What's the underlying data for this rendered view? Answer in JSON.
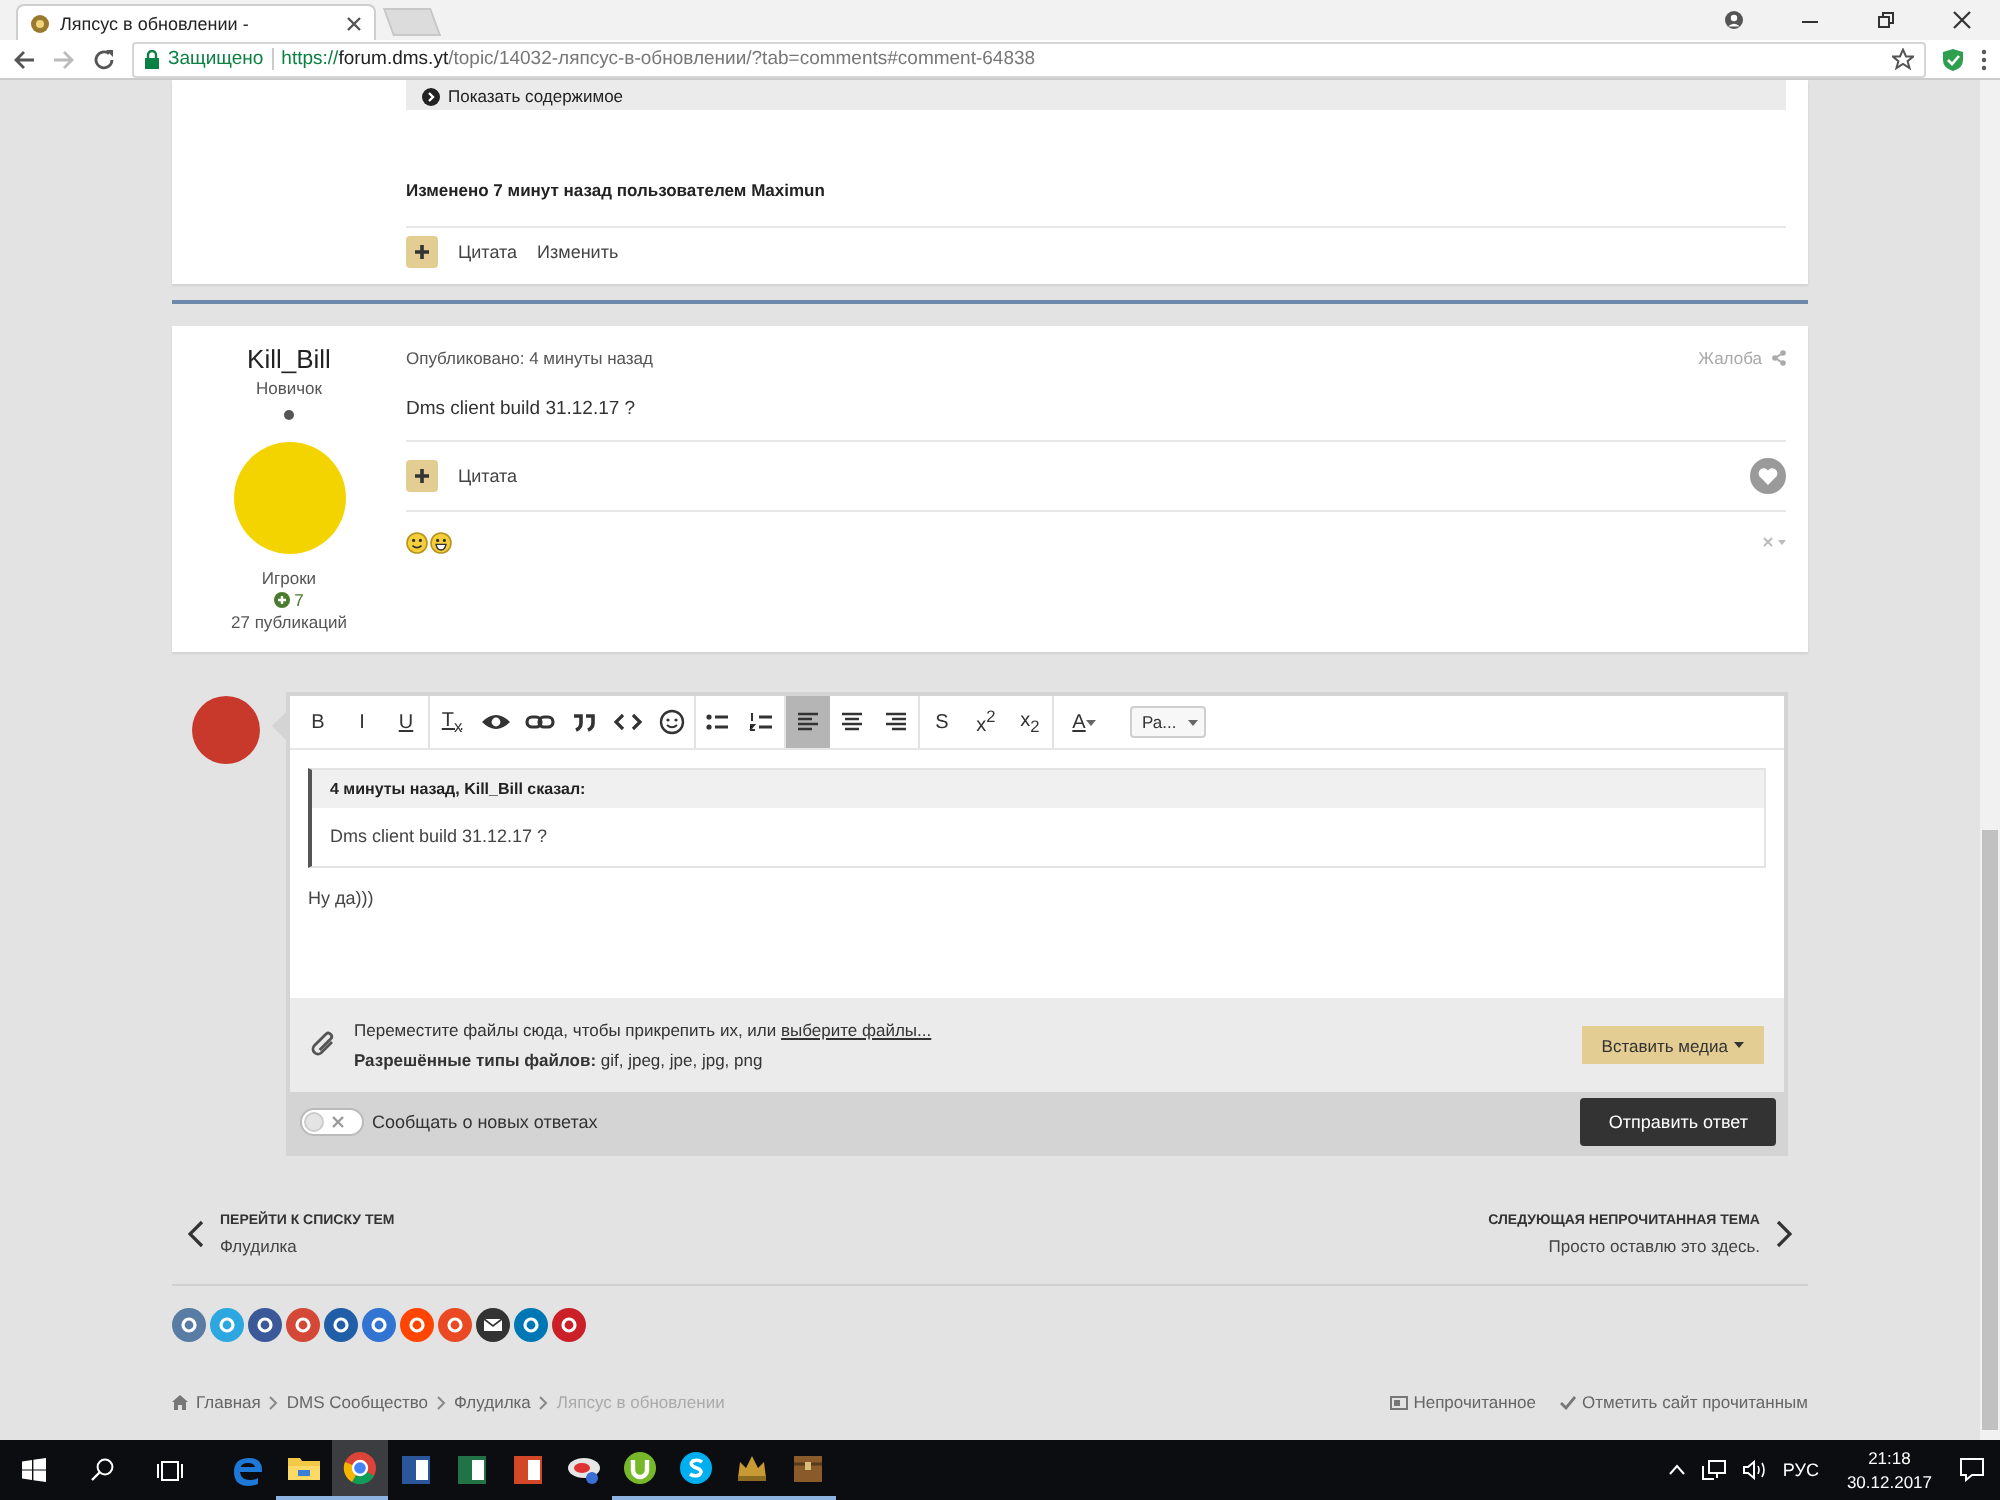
{
  "browser": {
    "tab_title": "Ляпсус в обновлении - ",
    "secure_label": "Защищено",
    "url_scheme": "https://",
    "url_host": "forum.dms.yt",
    "url_path": "/topic/14032-ляпсус-в-обновлении/?tab=comments#comment-64838"
  },
  "previous_post": {
    "spoiler_button": "Показать содержимое",
    "edited_note": "Изменено 7 минут назад пользователем Maximun",
    "actions": [
      "Цитата",
      "Изменить"
    ]
  },
  "post": {
    "author": "Kill_Bill",
    "rank": "Новичок",
    "group": "Игроки",
    "reputation": "7",
    "posts_count": "27 публикаций",
    "published": "Опубликовано: 4 минуты назад",
    "report": "Жалоба",
    "content": "Dms client build 31.12.17 ?",
    "actions": [
      "Цитата"
    ]
  },
  "editor": {
    "toolbar_groups": [
      {
        "items": [
          {
            "kind": "bold",
            "label": "B",
            "selected": false
          },
          {
            "kind": "italic",
            "label": "I",
            "selected": false
          },
          {
            "kind": "underline",
            "label": "U",
            "selected": false
          }
        ]
      },
      {
        "items": [
          {
            "kind": "clear",
            "label": "T$_{x}$",
            "selected": false
          },
          {
            "kind": "preview",
            "selected": false
          },
          {
            "kind": "link",
            "selected": false
          },
          {
            "kind": "quote",
            "selected": false
          },
          {
            "kind": "code",
            "selected": false
          },
          {
            "kind": "emoji",
            "selected": false
          }
        ]
      },
      {
        "items": [
          {
            "kind": "bullets",
            "selected": false
          },
          {
            "kind": "numbers",
            "selected": false
          }
        ]
      },
      {
        "items": [
          {
            "kind": "align-left",
            "selected": true
          },
          {
            "kind": "align-center",
            "selected": false
          },
          {
            "kind": "align-right",
            "selected": false
          }
        ]
      },
      {
        "items": [
          {
            "kind": "strike",
            "label": "S",
            "selected": false
          },
          {
            "kind": "superscript",
            "label": "x$^{2}$",
            "selected": false
          },
          {
            "kind": "subscript",
            "label": "x$_{2}$",
            "selected": false
          }
        ]
      },
      {
        "items": [
          {
            "kind": "color",
            "label": "A",
            "selected": false
          },
          {
            "kind": "font",
            "label": "Ра...",
            "selected": false
          }
        ]
      }
    ],
    "quote": {
      "header": "4 минуты назад, Kill_Bill сказал:",
      "text": "Dms client build 31.12.17 ?"
    },
    "value": "Ну да)))",
    "attach_text": "Переместите файлы сюда, чтобы прикрепить их, или ",
    "attach_link": "выберите файлы...",
    "allowed_types": "**Разрешённые типы файлов:** gif, jpeg, jpe, jpg, png",
    "insert_media": "Вставить медиа",
    "notify": {
      "label": "Сообщать о новых ответах",
      "on": false
    },
    "submit": "Отправить ответ"
  },
  "topic_nav": {
    "previous": {
      "heading": "ПЕРЕЙТИ К СПИСКУ ТЕМ",
      "title": "Флудилка"
    },
    "next": {
      "heading": "СЛЕДУЮЩАЯ НЕПРОЧИТАННАЯ ТЕМА",
      "title": "Просто оставлю это здесь."
    }
  },
  "share": [
    {
      "kind": "vk",
      "color": "#587ca3"
    },
    {
      "kind": "twitter",
      "color": "#2da7e0"
    },
    {
      "kind": "facebook",
      "color": "#3b5998"
    },
    {
      "kind": "google",
      "color": "#d34836"
    },
    {
      "kind": "digg",
      "color": "#205ea8"
    },
    {
      "kind": "delicious",
      "color": "#3274d1"
    },
    {
      "kind": "reddit",
      "color": "#ff4500"
    },
    {
      "kind": "stumble",
      "color": "#eb4924"
    },
    {
      "kind": "email",
      "color": "#333333"
    },
    {
      "kind": "linkedin",
      "color": "#0077b5"
    },
    {
      "kind": "pinterest",
      "color": "#cb2027"
    }
  ],
  "breadcrumbs": [
    "Главная",
    "DMS Сообщество",
    "Флудилка",
    "Ляпсус в обновлении"
  ],
  "footer_links": [
    "Непрочитанное",
    "Отметить сайт прочитанным"
  ],
  "taskbar": {
    "apps": [
      {
        "kind": "edge",
        "selected": false,
        "running": false
      },
      {
        "kind": "folder",
        "selected": false,
        "running": true
      },
      {
        "kind": "chrome",
        "selected": true,
        "running": true
      },
      {
        "kind": "word",
        "selected": false,
        "running": false
      },
      {
        "kind": "excel",
        "selected": false,
        "running": false
      },
      {
        "kind": "powerpoint",
        "selected": false,
        "running": false
      },
      {
        "kind": "paint",
        "selected": false,
        "running": false
      },
      {
        "kind": "torrent",
        "selected": false,
        "running": true
      },
      {
        "kind": "skype",
        "selected": false,
        "running": true
      },
      {
        "kind": "crown",
        "selected": false,
        "running": true
      },
      {
        "kind": "chest",
        "selected": false,
        "running": true
      }
    ],
    "language": "РУС",
    "time": "21:18",
    "date": "30.12.2017"
  }
}
